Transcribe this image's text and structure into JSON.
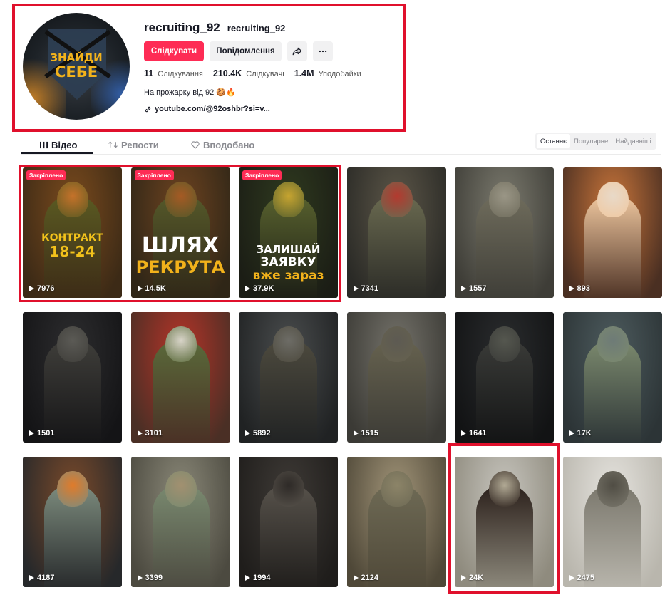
{
  "profile": {
    "username": "recruiting_92",
    "nickname": "recruiting_92",
    "avatar_text": [
      "ЗНАЙДИ",
      "СЕБЕ"
    ],
    "follow_label": "Слідкувати",
    "message_label": "Повідомлення",
    "share_icon": "share-icon",
    "more_icon": "more-icon",
    "stats": {
      "following_count": "11",
      "following_label": "Слідкування",
      "followers_count": "210.4K",
      "followers_label": "Слідкувачі",
      "likes_count": "1.4M",
      "likes_label": "Уподобайки"
    },
    "bio": "На прожарку від 92 🍪🔥",
    "link": "youtube.com/@92oshbr?si=v..."
  },
  "tabs": [
    {
      "label": "Відео",
      "icon": "grid-icon",
      "active": true
    },
    {
      "label": "Репости",
      "icon": "repost-icon",
      "active": false
    },
    {
      "label": "Вподобано",
      "icon": "heart-icon",
      "active": false
    }
  ],
  "sort": [
    {
      "label": "Останнє",
      "active": true
    },
    {
      "label": "Популярне",
      "active": false
    },
    {
      "label": "Найдавніші",
      "active": false
    }
  ],
  "pinned_label": "Закріплено",
  "videos": [
    {
      "views": "7976",
      "pinned": true,
      "caption": [
        "КОНТРАКТ",
        "18-24"
      ]
    },
    {
      "views": "14.5K",
      "pinned": true,
      "caption": [
        "ШЛЯХ",
        "РЕКРУТА"
      ]
    },
    {
      "views": "37.9K",
      "pinned": true,
      "caption": [
        "ЗАЛИШАЙ",
        "ЗАЯВКУ",
        "вже зараз"
      ]
    },
    {
      "views": "7341",
      "pinned": false
    },
    {
      "views": "1557",
      "pinned": false
    },
    {
      "views": "893",
      "pinned": false
    },
    {
      "views": "1501",
      "pinned": false
    },
    {
      "views": "3101",
      "pinned": false
    },
    {
      "views": "5892",
      "pinned": false
    },
    {
      "views": "1515",
      "pinned": false
    },
    {
      "views": "1641",
      "pinned": false
    },
    {
      "views": "17K",
      "pinned": false
    },
    {
      "views": "4187",
      "pinned": false
    },
    {
      "views": "3399",
      "pinned": false
    },
    {
      "views": "1994",
      "pinned": false
    },
    {
      "views": "2124",
      "pinned": false
    },
    {
      "views": "24K",
      "pinned": false
    },
    {
      "views": "2475",
      "pinned": false
    }
  ]
}
